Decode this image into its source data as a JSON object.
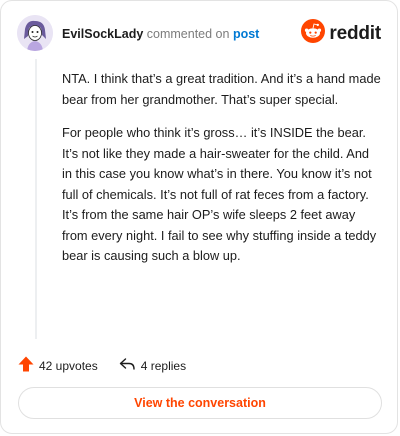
{
  "header": {
    "username": "EvilSockLady",
    "action_text": "commented on",
    "post_link": "post"
  },
  "brand": {
    "name": "reddit",
    "accent_color": "#ff4500"
  },
  "comment": {
    "paragraphs": [
      "NTA. I think that’s a great tradition. And it’s a hand made bear from her grandmother. That’s super special.",
      "For people who think it’s gross… it’s INSIDE the bear. It’s not like they made a hair-sweater for the child. And in this case you know what’s in there. You know it’s not full of chemicals. It’s not full of rat feces from a factory. It’s from the same hair OP’s wife sleeps 2 feet away from every night. I fail to see why stuffing inside a teddy bear is causing such a blow up."
    ]
  },
  "footer": {
    "upvotes": "42 upvotes",
    "replies": "4 replies",
    "upvote_icon": "upvote-arrow-icon",
    "reply_icon": "reply-arrow-icon"
  },
  "cta": {
    "label": "View the conversation"
  }
}
